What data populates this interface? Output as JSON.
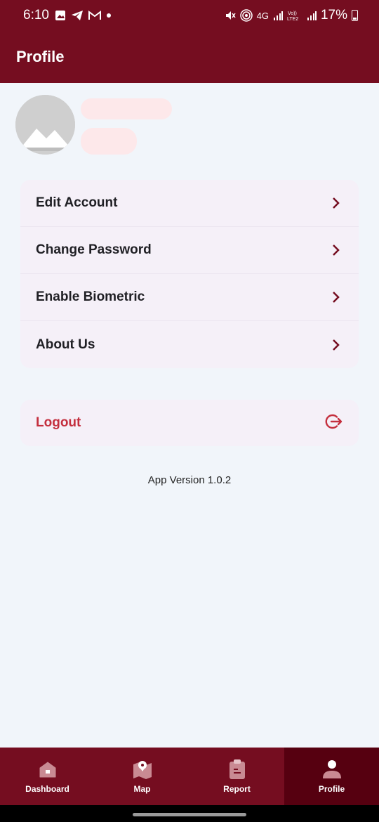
{
  "status_bar": {
    "time": "6:10",
    "network": "4G",
    "battery_percent": "17%",
    "left_icons": [
      "gallery-icon",
      "telegram-icon",
      "gmail-icon",
      "dot-icon"
    ],
    "right_icons": [
      "mute-icon",
      "hotspot-icon",
      "signal-icon",
      "volte-icon",
      "signal-icon",
      "battery-icon"
    ]
  },
  "header": {
    "title": "Profile"
  },
  "profile": {
    "name": "",
    "subtitle": ""
  },
  "menu": {
    "items": [
      {
        "label": "Edit Account"
      },
      {
        "label": "Change Password"
      },
      {
        "label": "Enable Biometric"
      },
      {
        "label": "About Us"
      }
    ]
  },
  "logout": {
    "label": "Logout"
  },
  "app_version": "App Version 1.0.2",
  "bottom_nav": {
    "items": [
      {
        "label": "Dashboard",
        "icon": "home-icon",
        "active": false
      },
      {
        "label": "Map",
        "icon": "map-icon",
        "active": false
      },
      {
        "label": "Report",
        "icon": "clipboard-icon",
        "active": false
      },
      {
        "label": "Profile",
        "icon": "person-icon",
        "active": true
      }
    ]
  },
  "colors": {
    "primary": "#750d20",
    "active_nav": "#560010",
    "logout_text": "#c42f3e",
    "card_bg": "#f5f0f8",
    "page_bg": "#f1f5fa"
  }
}
